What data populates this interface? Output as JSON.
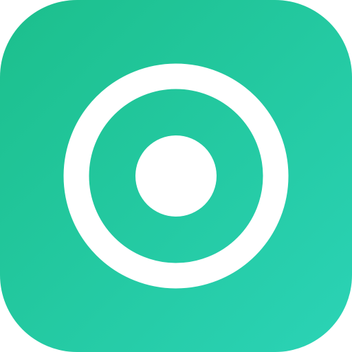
{
  "app_icon": {
    "glyph": "target-icon",
    "colors": {
      "gradient_start": "#1cbf8c",
      "gradient_end": "#2bd3b6",
      "glyph": "#ffffff"
    }
  }
}
